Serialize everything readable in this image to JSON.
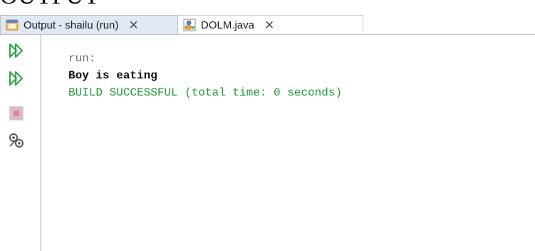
{
  "page_heading": "OUTPUT",
  "tabs": [
    {
      "label": "Output - shailu (run)",
      "close": "×",
      "icon": "output-window-icon"
    },
    {
      "label": "DOLM.java",
      "close": "×",
      "icon": "java-file-icon"
    }
  ],
  "toolbar": {
    "buttons": [
      {
        "name": "rerun-icon",
        "color": "#2ea84a"
      },
      {
        "name": "rerun-with-options-icon",
        "color": "#2ea84a"
      },
      {
        "name": "stop-icon",
        "color": "#c06070"
      },
      {
        "name": "settings-icon",
        "color": "#555555"
      }
    ]
  },
  "console": {
    "lines": [
      {
        "text": "run:",
        "kind": "run",
        "color": "#6e6e6e"
      },
      {
        "text": "Boy is eating",
        "kind": "output",
        "color": "#111111"
      },
      {
        "text": "BUILD SUCCESSFUL (total time: 0 seconds)",
        "kind": "build",
        "color": "#1f9a3a"
      }
    ]
  }
}
